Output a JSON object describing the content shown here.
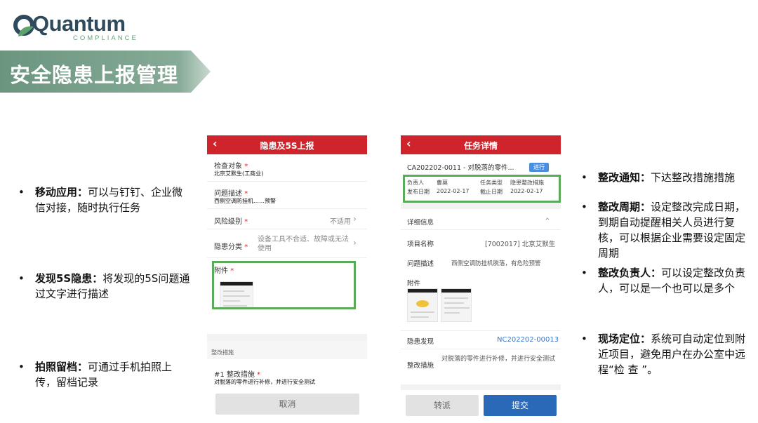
{
  "brand": {
    "name": "Quantum",
    "sub": "COMPLIANCE"
  },
  "page": {
    "title": "安全隐患上报管理"
  },
  "left_bullets": [
    {
      "head": "移动应用：",
      "body": "可以与钉钉、企业微信对接，随时执行任务"
    },
    {
      "head": "发现5S隐患：",
      "body": "将发现的5S问题通过文字进行描述"
    },
    {
      "head": "拍照留档：",
      "body": "可通过手机拍照上传，留档记录"
    }
  ],
  "right_bullets": [
    {
      "head": "整改通知：",
      "body": "下达整改措施措施"
    },
    {
      "head": "整改周期：",
      "body": "设定整改完成日期，到期自动提醒相关人员进行复核，可以根据企业需要设定固定周期"
    },
    {
      "head": "整改负责人：",
      "body": "可以设定整改负责人，可以是一个也可以是多个"
    },
    {
      "head": "现场定位：",
      "body": "系统可自动定位到附近项目，避免用户在办公室中远程“检 查 ”。"
    }
  ],
  "phone1": {
    "title": "隐患及5S上报",
    "inspect_label": "检查对象",
    "inspect_value": "北京艾默生(工商业)",
    "problem_label": "问题描述",
    "problem_value": "西侧空调防挂机……预警",
    "risk_label": "风险级别",
    "risk_value": "不适用",
    "category_label": "隐患分类",
    "category_value": "设备工具不合适、故障或无法使用",
    "attach_label": "附件",
    "rect_section": "整改措施",
    "measure_label": "#1 整改措施",
    "measure_value": "对脱落的零件进行补修，并进行安全测试",
    "cancel": "取消"
  },
  "phone2": {
    "title": "任务详情",
    "task_title": "CA202202-0011 - 对脱落的零件...",
    "status": "进行",
    "owner_label": "负责人",
    "owner_value": "曹莫",
    "type_label": "任务类型",
    "type_value": "隐患整改措施",
    "publish_label": "发布日期",
    "publish_value": "2022-02-17",
    "due_label": "截止日期",
    "due_value": "2022-02-17",
    "detail_label": "详细信息",
    "project_label": "项目名称",
    "project_value": "[7002017] 北京艾默生",
    "problem_label": "问题描述",
    "problem_value": "西侧空调防挂机脱落，有危险预警",
    "attach_label": "附件",
    "hazard_label": "隐患发现",
    "hazard_value": "NC202202-00013",
    "measure_label": "整改措施",
    "measure_value": "对脱落的零件进行补修，并进行安全测试",
    "transfer": "转派",
    "submit": "提交"
  },
  "colors": {
    "banner": "#6f9a86",
    "header_red": "#d0242c",
    "highlight": "#5aaa5a",
    "primary_blue": "#2a68b8"
  }
}
